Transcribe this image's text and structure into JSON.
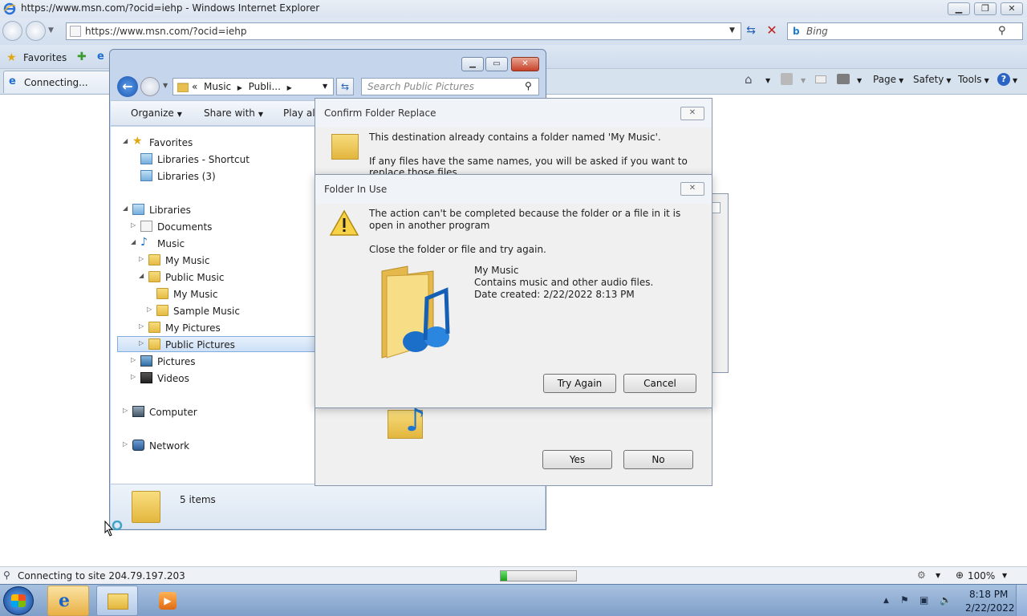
{
  "ie": {
    "window_title": "https://www.msn.com/?ocid=iehp - Windows Internet Explorer",
    "address": "https://www.msn.com/?ocid=iehp",
    "search_placeholder": "Bing",
    "favorites_label": "Favorites",
    "tab_label": "Connecting...",
    "commands": {
      "page": "Page",
      "safety": "Safety",
      "tools": "Tools",
      "help": "?"
    },
    "status_text": "Connecting to site 204.79.197.203",
    "progress": 0.08,
    "zoom": "100%"
  },
  "explorer": {
    "breadcrumb": {
      "prefix": "«",
      "items": [
        "Music",
        "Publi..."
      ]
    },
    "search_placeholder": "Search Public Pictures",
    "toolbar": {
      "organize": "Organize",
      "share_with": "Share with",
      "play_all": "Play all"
    },
    "tree": [
      {
        "label": "Favorites",
        "icon": "star-icon"
      },
      {
        "label": "Libraries - Shortcut",
        "icon": "library-icon"
      },
      {
        "label": "Libraries (3)",
        "icon": "library-icon"
      },
      {
        "label": "Libraries",
        "icon": "library-icon"
      },
      {
        "label": "Documents",
        "icon": "documents-icon"
      },
      {
        "label": "Music",
        "icon": "music-icon"
      },
      {
        "label": "My Music",
        "icon": "folder-icon"
      },
      {
        "label": "Public Music",
        "icon": "folder-icon"
      },
      {
        "label": "My Music",
        "icon": "folder-icon"
      },
      {
        "label": "Sample Music",
        "icon": "folder-icon"
      },
      {
        "label": "My Pictures",
        "icon": "folder-icon"
      },
      {
        "label": "Public Pictures",
        "icon": "folder-icon",
        "selected": true
      },
      {
        "label": "Pictures",
        "icon": "pictures-icon"
      },
      {
        "label": "Videos",
        "icon": "videos-icon"
      },
      {
        "label": "Computer",
        "icon": "computer-icon"
      },
      {
        "label": "Network",
        "icon": "network-icon"
      }
    ],
    "status_count": "5 items"
  },
  "confirm_dialog": {
    "title": "Confirm Folder Replace",
    "message": "This destination already contains a folder named 'My Music'.",
    "message2": "If any files have the same names, you will be asked if you want to replace those files.",
    "yes": "Yes",
    "no": "No"
  },
  "inuse_dialog": {
    "title": "Folder In Use",
    "message": "The action can't be completed because the folder or a file in it is open in another program",
    "instruction": "Close the folder or file and try again.",
    "file_name": "My Music",
    "file_desc": "Contains music and other audio files.",
    "file_date": "Date created: 2/22/2022 8:13 PM",
    "try_again": "Try Again",
    "cancel": "Cancel"
  },
  "taskbar": {
    "time": "8:18 PM",
    "date": "2/22/2022"
  },
  "colors": {
    "accent": "#2a64c4",
    "selection": "#cde0f7",
    "progress": "#1ca11c"
  }
}
